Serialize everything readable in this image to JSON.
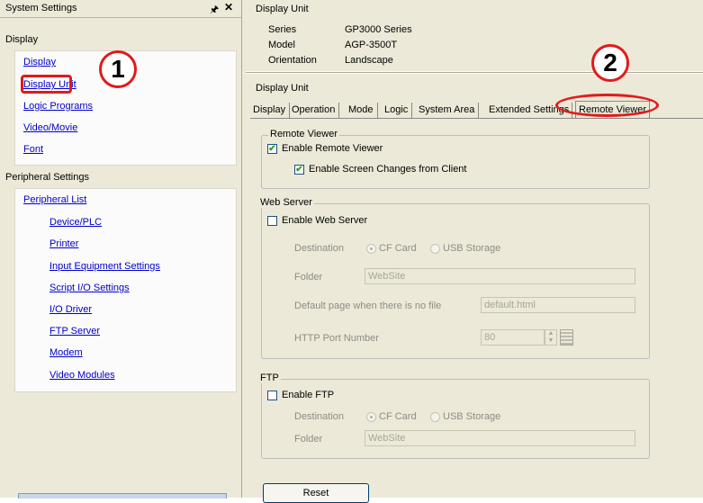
{
  "left_panel": {
    "title": "System Settings",
    "pin_icon": "pin-icon",
    "close_icon": "close-icon",
    "display_header": "Display",
    "display_items": [
      "Display",
      "Display Unit",
      "Logic Programs",
      "Video/Movie",
      "Font"
    ],
    "peripheral_header": "Peripheral Settings",
    "peripheral_list": "Peripheral List",
    "peripheral_items": [
      "Device/PLC",
      "Printer",
      "Input Equipment Settings",
      "Script I/O Settings",
      "I/O Driver",
      "FTP Server",
      "Modem",
      "Video Modules"
    ]
  },
  "info": {
    "title": "Display Unit",
    "series_label": "Series",
    "series_value": "GP3000 Series",
    "model_label": "Model",
    "model_value": "AGP-3500T",
    "orientation_label": "Orientation",
    "orientation_value": "Landscape"
  },
  "props": {
    "title": "Display Unit",
    "tabs": [
      "Display",
      "Operation",
      "Mode",
      "Logic",
      "System Area",
      "Extended Settings",
      "Remote Viewer"
    ],
    "active_tab": "Remote Viewer"
  },
  "remote_viewer": {
    "group_title": "Remote Viewer",
    "enable_label": "Enable Remote Viewer",
    "enable_checked": true,
    "screen_changes_label": "Enable Screen Changes from Client",
    "screen_changes_checked": true
  },
  "web_server": {
    "group_title": "Web Server",
    "enable_label": "Enable Web Server",
    "enable_checked": false,
    "destination_label": "Destination",
    "dest_cf": "CF Card",
    "dest_usb": "USB Storage",
    "folder_label": "Folder",
    "folder_value": "WebSite",
    "default_page_label": "Default page when there is no file",
    "default_page_value": "default.html",
    "port_label": "HTTP Port Number",
    "port_value": "80"
  },
  "ftp": {
    "group_title": "FTP",
    "enable_label": "Enable FTP",
    "enable_checked": false,
    "destination_label": "Destination",
    "dest_cf": "CF Card",
    "dest_usb": "USB Storage",
    "folder_label": "Folder",
    "folder_value": "WebSite"
  },
  "reset_label": "Reset",
  "annotations": {
    "step1": "1",
    "step2": "2",
    "color": "#e21a1a"
  },
  "colors": {
    "panel_bg": "#ece9d8",
    "link": "#0000cc",
    "check": "#21a121"
  }
}
